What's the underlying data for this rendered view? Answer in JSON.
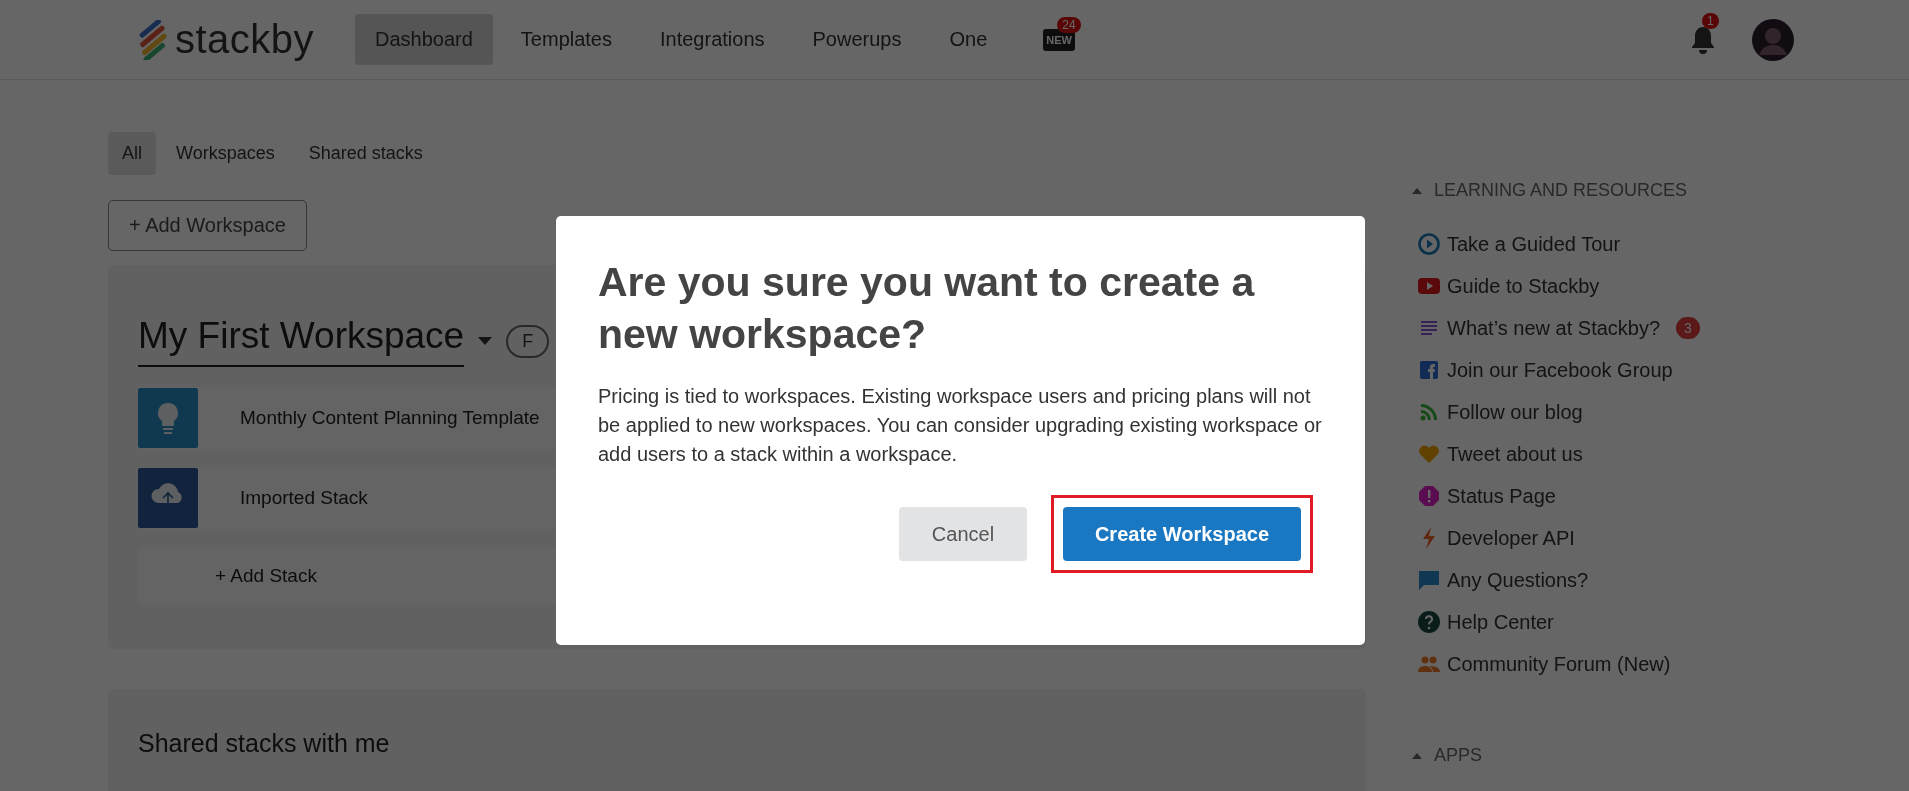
{
  "header": {
    "logo": "stackby",
    "nav": [
      {
        "label": "Dashboard",
        "selected": true
      },
      {
        "label": "Templates",
        "selected": false
      },
      {
        "label": "Integrations",
        "selected": false
      },
      {
        "label": "Powerups",
        "selected": false
      },
      {
        "label": "One",
        "selected": false
      }
    ],
    "new_badge": {
      "label": "NEW",
      "count": "24"
    },
    "notifications": {
      "count": "1"
    }
  },
  "filters": [
    {
      "label": "All",
      "selected": true
    },
    {
      "label": "Workspaces",
      "selected": false
    },
    {
      "label": "Shared stacks",
      "selected": false
    }
  ],
  "add_workspace": "+ Add Workspace",
  "workspace": {
    "title": "My First Workspace",
    "pill": "F",
    "stacks": [
      {
        "name": "Monthly Content Planning Template",
        "kind": "bulb"
      },
      {
        "name": "Imported Stack",
        "kind": "cloud"
      }
    ],
    "add_stack": "+ Add Stack"
  },
  "shared": {
    "title": "Shared stacks with me"
  },
  "sidebar": {
    "sections": [
      {
        "title": "LEARNING AND RESOURCES",
        "expanded": true,
        "items": [
          {
            "label": "Take a Guided Tour",
            "kind": "play-circle"
          },
          {
            "label": "Guide to Stackby",
            "kind": "video"
          },
          {
            "label": "What’s new at Stackby?",
            "kind": "lines",
            "badge": "3"
          },
          {
            "label": "Join our Facebook Group",
            "kind": "facebook"
          },
          {
            "label": "Follow our blog",
            "kind": "rss"
          },
          {
            "label": "Tweet about us",
            "kind": "heart"
          },
          {
            "label": "Status Page",
            "kind": "alert"
          },
          {
            "label": "Developer API",
            "kind": "bolt"
          },
          {
            "label": "Any Questions?",
            "kind": "chat"
          },
          {
            "label": "Help Center",
            "kind": "help"
          },
          {
            "label": "Community Forum (New)",
            "kind": "people"
          }
        ]
      },
      {
        "title": "APPS",
        "expanded": true
      }
    ]
  },
  "modal": {
    "title": "Are you sure you want to create a new workspace?",
    "body": "Pricing is tied to workspaces. Existing workspace users and pricing plans will not be applied to new workspaces. You can consider upgrading existing workspace or add users to a stack within a workspace.",
    "buttons": [
      {
        "label": "Cancel",
        "kind": "secondary",
        "highlighted": false
      },
      {
        "label": "Create Workspace",
        "kind": "primary",
        "highlighted": true
      }
    ]
  }
}
